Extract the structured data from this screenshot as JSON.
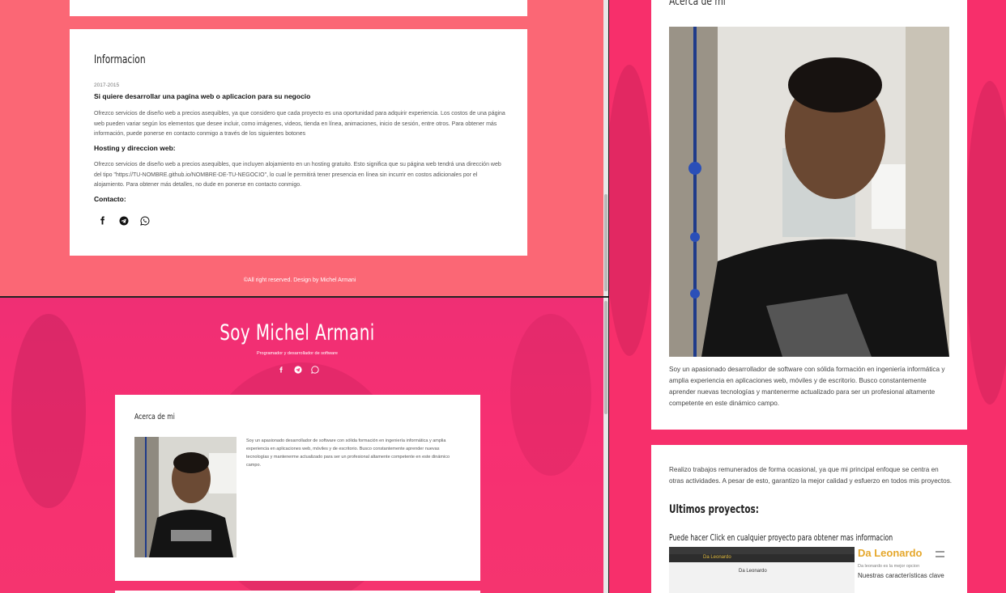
{
  "top_left": {
    "info_card": {
      "title": "Informacion",
      "date": "2017-2015",
      "section1_heading": "Si quiere desarrollar una pagina web o aplicacion para su negocio",
      "section1_text": "Ofrezco servicios de diseño web a precios asequibles, ya que considero que cada proyecto es una oportunidad para adquirir experiencia. Los costos de una página web pueden variar según los elementos que desee incluir, como imágenes, videos, tienda en línea, animaciones, inicio de sesión, entre otros. Para obtener más información, puede ponerse en contacto conmigo a través de los siguientes botones",
      "section2_heading": "Hosting y direccion web:",
      "section2_text": "Ofrezco servicios de diseño web a precios asequibles, que incluyen alojamiento en un hosting gratuito. Esto significa que su página web tendrá una dirección web del tipo \"https://TU-NOMBRE.github.io/NOMBRE-DE-TU-NEGOCIO\", lo cual le permitirá tener presencia en línea sin incurrir en costos adicionales por el alojamiento. Para obtener más detalles, no dude en ponerse en contacto conmigo.",
      "contact_label": "Contacto:",
      "contact_icons": [
        "facebook-icon",
        "telegram-icon",
        "whatsapp-icon"
      ]
    },
    "footer": "©All right reserved. Design by Michel Armani"
  },
  "bottom_left": {
    "hero": {
      "title": "Soy Michel Armani",
      "subtitle": "Programador y desarrollador de software",
      "icons": [
        "facebook-icon",
        "telegram-icon",
        "whatsapp-icon"
      ]
    },
    "about": {
      "title": "Acerca de mi",
      "text": "Soy un apasionado desarrollador de software con sólida formación en ingeniería informática y amplia experiencia en aplicaciones web, móviles y de escritorio. Busco constantemente aprender nuevas tecnologías y mantenerme actualizado para ser un profesional altamente competente en este dinámico campo."
    }
  },
  "right": {
    "about": {
      "title": "Acerca de mi",
      "text": "Soy un apasionado desarrollador de software con sólida formación en ingeniería informática y amplia experiencia en aplicaciones web, móviles y de escritorio. Busco constantemente aprender nuevas tecnologías y mantenerme actualizado para ser un profesional altamente competente en este dinámico campo."
    },
    "projects": {
      "intro": "Realizo trabajos remunerados de forma ocasional, ya que mi principal enfoque se centra en otras actividades. A pesar de esto, garantizo la mejor calidad y esfuerzo en todos mis proyectos.",
      "heading": "Ultimos proyectos:",
      "click_hint": "Puede hacer Click en cualquier proyecto para obtener mas informacion",
      "thumbnail": {
        "brand": "Da Leonardo",
        "center_label": "Da Leonardo",
        "tagline": "Da leonardo es la mejor opcion",
        "features": "Nuestras características clave"
      }
    }
  },
  "colors": {
    "top_left_bg": "#fb6775",
    "hero_bg": "#f72f72",
    "right_bg": "#f72f6b",
    "card_bg": "#ffffff",
    "brand_gold": "#e5a72b"
  }
}
